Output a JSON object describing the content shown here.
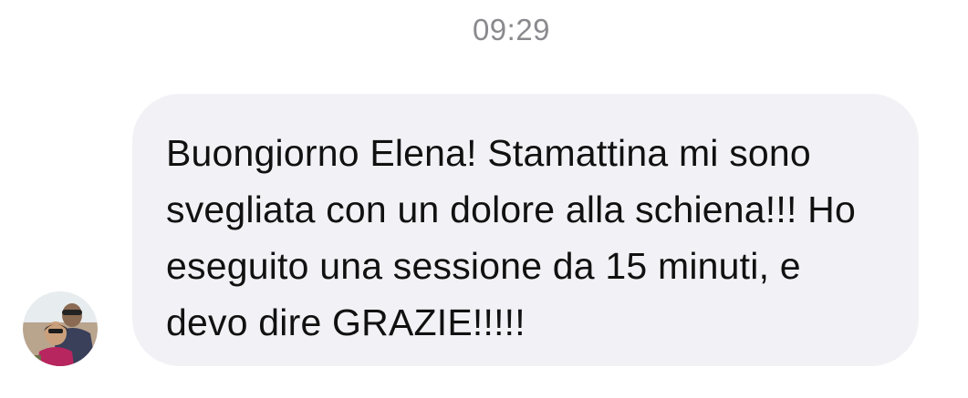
{
  "chat": {
    "timestamp": "09:29",
    "message": {
      "text": "Buongiorno Elena! Stamattina mi sono svegliata con un dolore alla schiena!!! Ho eseguito una sessione da 15 minuti, e devo dire GRAZIE!!!!!",
      "avatar": "user-photo-avatar"
    }
  },
  "colors": {
    "background": "#ffffff",
    "bubble": "#f2f2f6",
    "timestamp": "#8a8a8e",
    "text": "#111111"
  }
}
